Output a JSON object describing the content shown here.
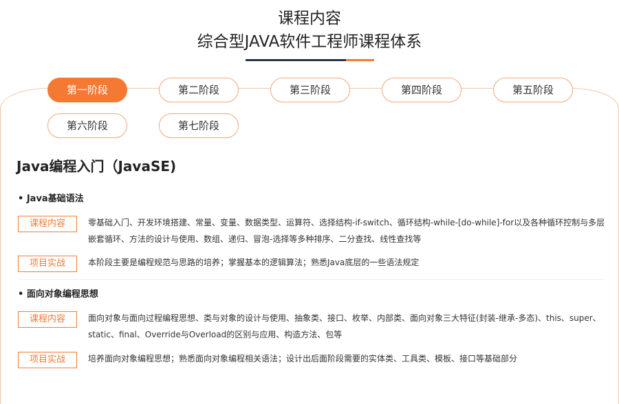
{
  "header": {
    "title": "课程内容",
    "subtitle": "综合型JAVA软件工程师课程体系"
  },
  "tabs": [
    {
      "label": "第一阶段",
      "active": true
    },
    {
      "label": "第二阶段",
      "active": false
    },
    {
      "label": "第三阶段",
      "active": false
    },
    {
      "label": "第四阶段",
      "active": false
    },
    {
      "label": "第五阶段",
      "active": false
    },
    {
      "label": "第六阶段",
      "active": false
    },
    {
      "label": "第七阶段",
      "active": false
    }
  ],
  "section": {
    "title": "Java编程入门（JavaSE)",
    "groups": [
      {
        "title": "• Java基础语法",
        "content_tag": "课程内容",
        "content_text": "零基础入门、开发环境搭建、常量、变量、数据类型、运算符、选择结构-if-switch、循环结构-while-[do-while]-for以及各种循环控制与多层嵌套循环、方法的设计与使用、数组、递归、冒泡-选择等多种排序、二分查找、线性查找等",
        "practice_tag": "项目实战",
        "practice_text": "本阶段主要是编程规范与思路的培养；掌握基本的逻辑算法；熟悉Java底层的一些语法规定"
      },
      {
        "title": "• 面向对象编程思想",
        "content_tag": "课程内容",
        "content_text": "面向对象与面向过程编程思想、类与对象的设计与使用、抽象类、接口、枚举、内部类、面向对象三大特征(封装-继承-多态)、this、super、static、final、Override与Overload的区别与应用、构造方法、包等",
        "practice_tag": "项目实战",
        "practice_text": "培养面向对象编程思想；熟悉面向对象编程相关语法；设计出后面阶段需要的实体类、工具类、模板、接口等基础部分"
      }
    ]
  },
  "colors": {
    "accent": "#f47a33",
    "dark_line": "#2a3142",
    "tab_border": "#f0a67a"
  }
}
